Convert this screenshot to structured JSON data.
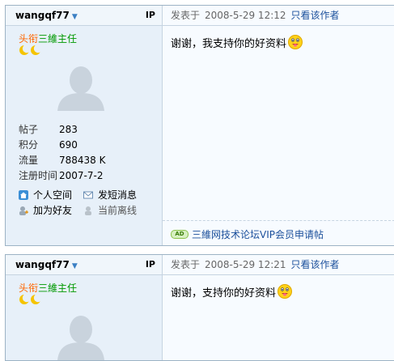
{
  "posts": [
    {
      "username": "wangqf77",
      "ip_label": "IP",
      "rank_key": "头衔",
      "rank_value": "三維主任",
      "stats": [
        {
          "k": "帖子",
          "v": "283"
        },
        {
          "k": "积分",
          "v": "690"
        },
        {
          "k": "流量",
          "v": "788438 K"
        },
        {
          "k": "注册时间",
          "v": "2007-7-2"
        }
      ],
      "links": [
        "个人空间",
        "发短消息",
        "加为好友",
        "当前离线"
      ],
      "posted_prefix": "发表于",
      "posted_at": "2008-5-29 12:12",
      "author_only": "只看该作者",
      "message": "谢谢，我支持你的好资料",
      "signature_badge": "AD",
      "signature_link": "三維网技术论坛VIP会员申请帖"
    },
    {
      "username": "wangqf77",
      "ip_label": "IP",
      "rank_key": "头衔",
      "rank_value": "三維主任",
      "posted_prefix": "发表于",
      "posted_at": "2008-5-29 12:21",
      "author_only": "只看该作者",
      "message": "谢谢，支持你的好资料"
    }
  ],
  "colors": {
    "border": "#9db3c5",
    "sidebar_bg": "#e7f0f9",
    "link": "#1b4f9b",
    "rank_key": "#ff6600",
    "rank_value": "#009900"
  },
  "icons": [
    "chevron-down-icon",
    "moon-icon",
    "avatar-placeholder-icon",
    "home-icon",
    "mail-icon",
    "add-friend-icon",
    "offline-user-icon",
    "smiley-icon",
    "ad-badge-icon"
  ]
}
